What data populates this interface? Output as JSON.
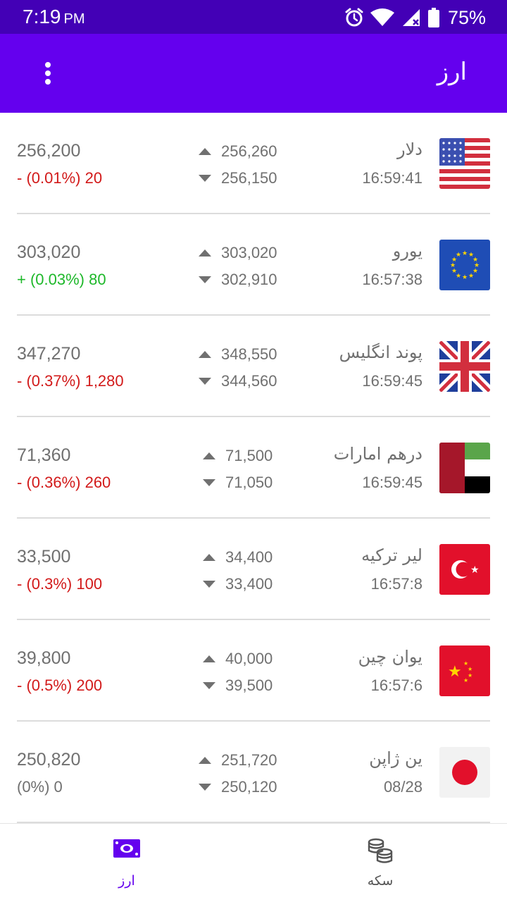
{
  "status_bar": {
    "time": "7:19",
    "ampm": "PM",
    "battery": "75%",
    "icons": [
      "alarm-icon",
      "wifi-icon",
      "signal-icon",
      "battery-icon"
    ]
  },
  "app_bar": {
    "title": "ارز",
    "menu_icon": "more-vert-icon"
  },
  "colors": {
    "status_bar": "#4300b6",
    "app_bar": "#6400ee",
    "negative": "#d21a1a",
    "positive": "#1eb82a",
    "active_nav": "#6400ee"
  },
  "rates": [
    {
      "name": "دلار",
      "time": "16:59:41",
      "high": "256,260",
      "low": "256,150",
      "price": "256,200",
      "change": "- (0.01%) 20",
      "trend": "neg",
      "flag": "us-flag"
    },
    {
      "name": "یورو",
      "time": "16:57:38",
      "high": "303,020",
      "low": "302,910",
      "price": "303,020",
      "change": "+ (0.03%) 80",
      "trend": "pos",
      "flag": "eu-flag"
    },
    {
      "name": "پوند انگلیس",
      "time": "16:59:45",
      "high": "348,550",
      "low": "344,560",
      "price": "347,270",
      "change": "- (0.37%) 1,280",
      "trend": "neg",
      "flag": "uk-flag"
    },
    {
      "name": "درهم امارات",
      "time": "16:59:45",
      "high": "71,500",
      "low": "71,050",
      "price": "71,360",
      "change": "- (0.36%) 260",
      "trend": "neg",
      "flag": "uae-flag"
    },
    {
      "name": "لیر ترکیه",
      "time": "16:57:8",
      "high": "34,400",
      "low": "33,400",
      "price": "33,500",
      "change": "- (0.3%) 100",
      "trend": "neg",
      "flag": "turkey-flag"
    },
    {
      "name": "یوان چین",
      "time": "16:57:6",
      "high": "40,000",
      "low": "39,500",
      "price": "39,800",
      "change": "- (0.5%) 200",
      "trend": "neg",
      "flag": "china-flag"
    },
    {
      "name": "ین ژاپن",
      "time": "08/28",
      "high": "251,720",
      "low": "250,120",
      "price": "250,820",
      "change": "(0%) 0",
      "trend": "zero",
      "flag": "japan-flag"
    }
  ],
  "bottom_nav": {
    "items": [
      {
        "label": "ارز",
        "icon": "banknote-icon",
        "active": true
      },
      {
        "label": "سکه",
        "icon": "coins-icon",
        "active": false
      }
    ]
  }
}
